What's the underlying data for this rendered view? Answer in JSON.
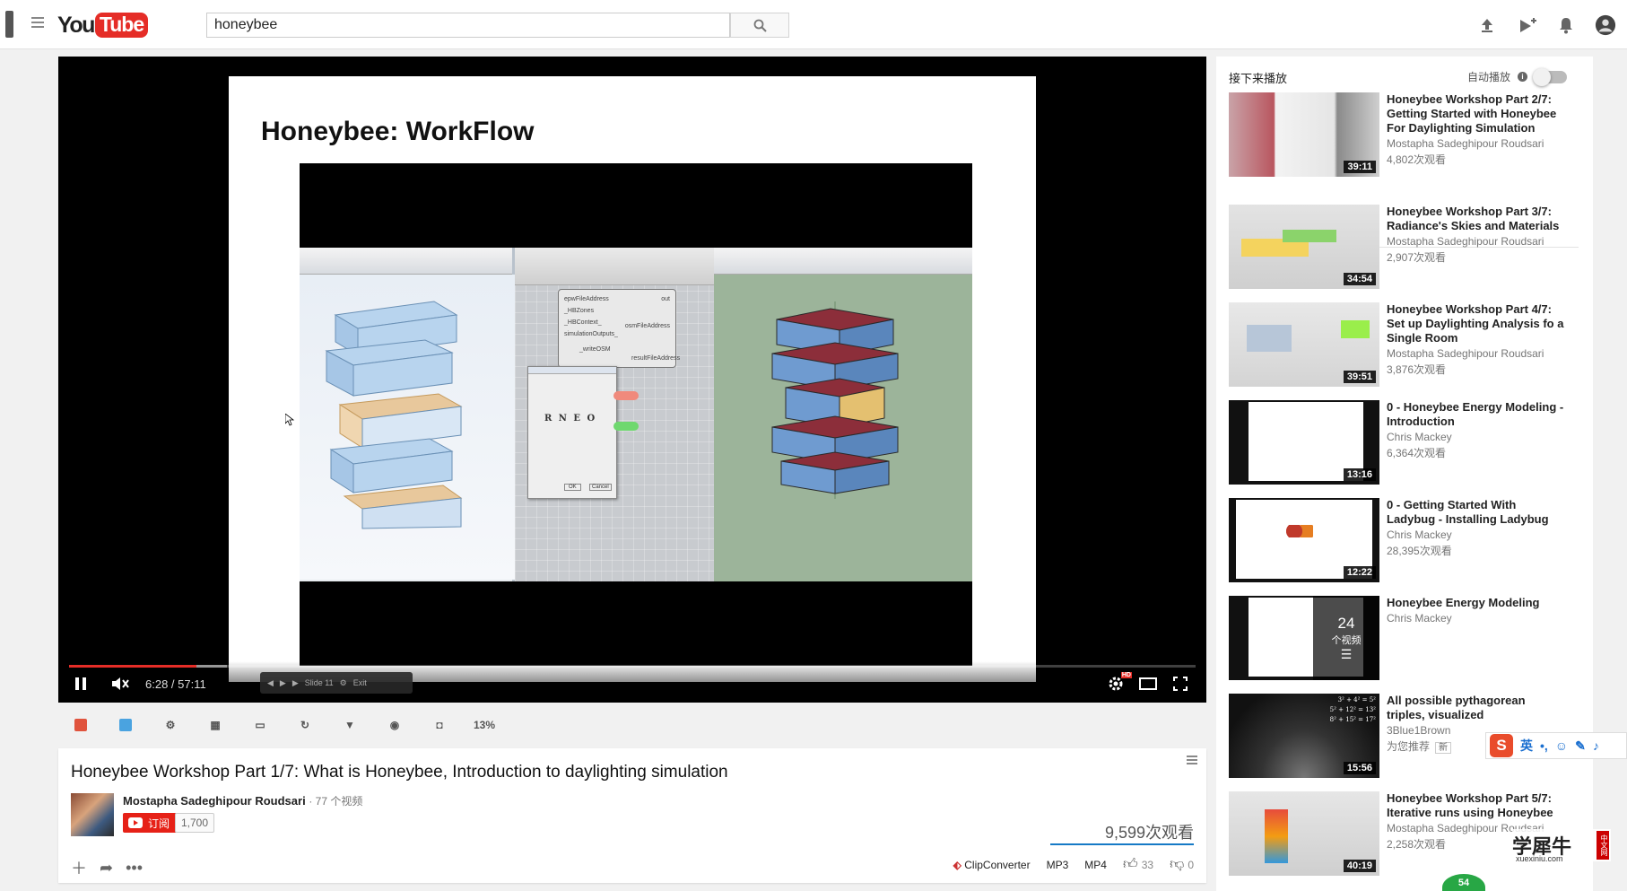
{
  "header": {
    "logo_you": "You",
    "logo_tube": "Tube",
    "search_value": "honeybee",
    "icons": [
      "upload-icon",
      "create-video-icon",
      "notifications-bell-icon",
      "account-avatar-icon"
    ]
  },
  "player": {
    "slide_title": "Honeybee: WorkFlow",
    "time_display": "6:28 / 57:11",
    "progress_fraction": 0.113,
    "slide_nav_label": "Slide 11",
    "slide_exit": "Exit",
    "hd_badge": "HD",
    "dialog_letters": "R N E O",
    "dialog_ok": "OK",
    "dialog_cancel": "Cancel",
    "gh_nodes": [
      "epwFileAddress",
      "_HBZones",
      "_HBContext_",
      "simulationOutputs_",
      "_writeOSM",
      "osmFileAddress",
      "resultFileAddress",
      "out"
    ]
  },
  "extension_bar": {
    "percent": "13%",
    "icons": [
      "red-square-icon",
      "blue-square-icon",
      "gear-icon",
      "film-icon",
      "screen-icon",
      "refresh-icon",
      "filter-icon",
      "globe-icon",
      "camera-icon"
    ]
  },
  "video": {
    "title": "Honeybee Workshop Part 1/7: What is Honeybee, Introduction to daylighting simulation",
    "channel": "Mostapha Sadeghipour Roudsari",
    "channel_meta": "· 77 个视频",
    "subscribe_label": "订阅",
    "subscriber_count": "1,700",
    "views": "9,599次观看",
    "downloader": "ClipConverter",
    "mp3": "MP3",
    "mp4": "MP4",
    "likes": "33",
    "dislikes": "0"
  },
  "sidebar": {
    "up_next": "接下来播放",
    "autoplay": "自动播放",
    "items": [
      {
        "title": "Honeybee Workshop Part 2/7: Getting Started with Honeybee For Daylighting Simulation",
        "channel": "Mostapha Sadeghipour Roudsari",
        "views": "4,802次观看",
        "duration": "39:11"
      },
      {
        "title": "Honeybee Workshop Part 3/7: Radiance's Skies and Materials",
        "channel": "Mostapha Sadeghipour Roudsari",
        "views": "2,907次观看",
        "duration": "34:54"
      },
      {
        "title": "Honeybee Workshop Part 4/7: Set up Daylighting Analysis fo a Single Room",
        "channel": "Mostapha Sadeghipour Roudsari",
        "views": "3,876次观看",
        "duration": "39:51"
      },
      {
        "title": "0 - Honeybee Energy Modeling - Introduction",
        "channel": "Chris Mackey",
        "views": "6,364次观看",
        "duration": "13:16"
      },
      {
        "title": "0 - Getting Started With Ladybug - Installing Ladybug",
        "channel": "Chris Mackey",
        "views": "28,395次观看",
        "duration": "12:22"
      },
      {
        "title": "Honeybee Energy Modeling",
        "channel": "Chris Mackey",
        "playlist_count": "24",
        "playlist_label": "个视频"
      },
      {
        "title": "All possible pythagorean triples, visualized",
        "channel": "3Blue1Brown",
        "views": "为您推荐",
        "badge": "新",
        "duration": "15:56"
      },
      {
        "title": "Honeybee Workshop Part 5/7: Iterative runs using Honeybee",
        "channel": "Mostapha Sadeghipour Roudsari",
        "views": "2,258次观看",
        "duration": "40:19"
      }
    ]
  },
  "overlays": {
    "ime_lang": "英",
    "ime_logo": "S",
    "watermark_main": "学犀牛",
    "watermark_url": "xuexiniu.com",
    "watermark_tag": "中文网",
    "badge_number": "54",
    "formula": [
      "3² + 4² = 5²",
      "5² + 12² = 13²",
      "8² + 15² = 17²"
    ]
  },
  "colors": {
    "brand_red": "#e52d27",
    "subscribe_red": "#e62117",
    "link_blue": "#167ac6"
  }
}
